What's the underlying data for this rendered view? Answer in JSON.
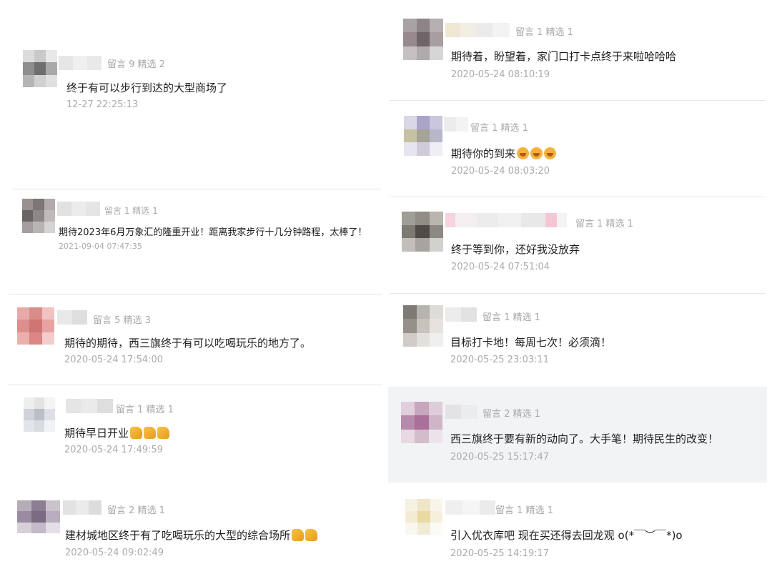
{
  "left": [
    {
      "meta": "留言 9 精选 2",
      "comment": "终于有可以步行到达的大型商场了",
      "time": "12-27 22:25:13",
      "emoji": []
    },
    {
      "meta": "留言 1 精选 1",
      "comment": "期待2023年6月万象汇的隆重开业！距离我家步行十几分钟路程，太棒了！",
      "time": "2021-09-04 07:47:35",
      "emoji": []
    },
    {
      "meta": "留言 5 精选 3",
      "comment": "期待的期待，西三旗终于有可以吃喝玩乐的地方了。",
      "time": "2020-05-24 17:54:00",
      "emoji": []
    },
    {
      "meta": "留言 1 精选 1",
      "comment": "期待早日开业",
      "time": "2020-05-24 17:49:59",
      "emoji": [
        "thumbs-up",
        "thumbs-up",
        "thumbs-up"
      ]
    },
    {
      "meta": "留言 2 精选 1",
      "comment": "建材城地区终于有了吃喝玩乐的大型的综合场所",
      "time": "2020-05-24 09:02:49",
      "emoji": [
        "thumbs-up",
        "thumbs-up"
      ]
    }
  ],
  "right": [
    {
      "meta": "留言 1 精选 1",
      "comment": "期待着，盼望着，家门口打卡点终于来啦哈哈哈",
      "time": "2020-05-24 08:10:19",
      "emoji": []
    },
    {
      "meta": "留言 1 精选 1",
      "comment": "期待你的到来",
      "time": "2020-05-24 08:03:20",
      "emoji": [
        "laughing-face",
        "laughing-face",
        "laughing-face"
      ]
    },
    {
      "meta": "留言 1 精选 1",
      "comment": "终于等到你，还好我没放弃",
      "time": "2020-05-24 07:51:04",
      "emoji": []
    },
    {
      "meta": "留言 1 精选 1",
      "comment": "目标打卡地！每周七次！必须滴！",
      "time": "2020-05-25 23:03:11",
      "emoji": []
    },
    {
      "meta": "留言 2 精选 1",
      "comment": "西三旗终于要有新的动向了。大手笔！期待民生的改变！",
      "time": "2020-05-25 15:17:47",
      "emoji": []
    },
    {
      "meta": "留言 1 精选 1",
      "comment": "引入优衣库吧 现在买还得去回龙观 o(*￣︶￣*)o",
      "time": "2020-05-25 14:19:17",
      "emoji": []
    }
  ]
}
